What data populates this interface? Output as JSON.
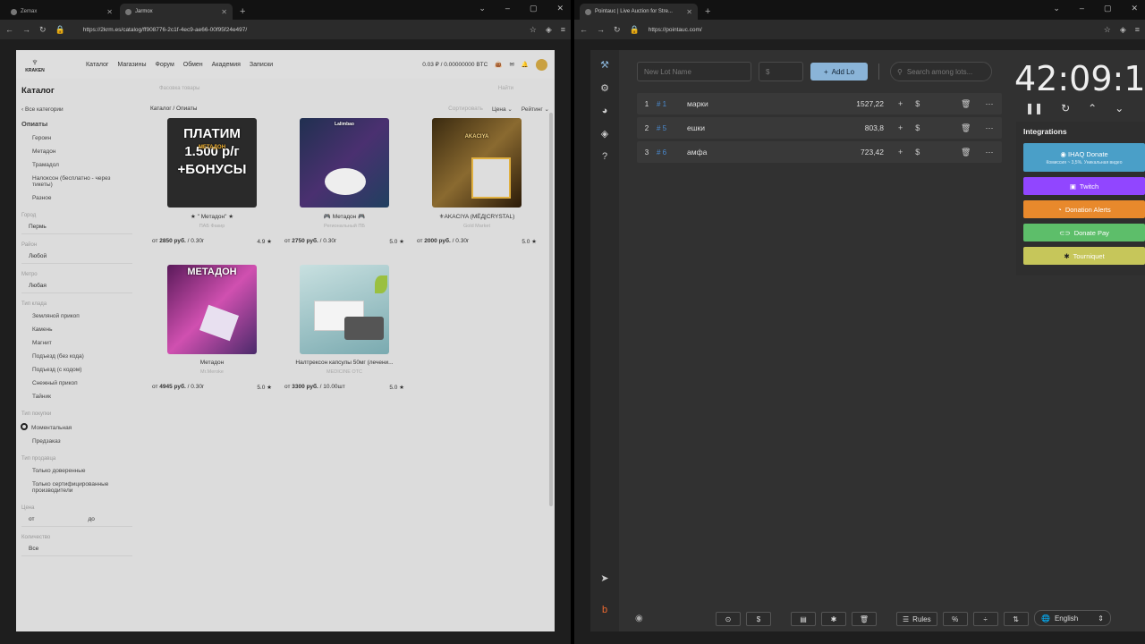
{
  "left": {
    "tabs": [
      {
        "label": "Zemax"
      },
      {
        "label": "Jarmox"
      }
    ],
    "url": "https://2krm.es/catalog/ff908776-2c1f-4ec9-ae66-00f95f24e497/",
    "logo_text": "KRAKEN",
    "nav": [
      "Каталог",
      "Магазины",
      "Форум",
      "Обмен",
      "Академия",
      "Записки"
    ],
    "balance": "0.03 ₽ / 0.00000000 BTC",
    "sidebar": {
      "title": "Каталог",
      "back": "Все категории",
      "group": "Опиаты",
      "items": [
        "Героин",
        "Метадон",
        "Трамадол",
        "Налоксон (бесплатно - через тикеты)",
        "Разное"
      ],
      "city_label": "Город",
      "city": "Пермь",
      "district_label": "Район",
      "district": "Любой",
      "metro_label": "Метро",
      "metro": "Любая",
      "type_label": "Тип клада",
      "types": [
        "Земляной прикоп",
        "Камень",
        "Магнит",
        "Подъезд (без кода)",
        "Подъезд (с кодом)",
        "Снежный прикоп",
        "Тайник"
      ],
      "buy_label": "Тип покупки",
      "buy_types": [
        "Моментальная",
        "Предзаказ"
      ],
      "seller_label": "Тип продавца",
      "seller_types": [
        "Только доверенные",
        "Только сертифицированные производители"
      ],
      "price_label": "Цена",
      "price_from": "от",
      "price_to": "до",
      "qty_label": "Количество",
      "qty": "Все"
    },
    "search_placeholder": "Фасовка товары",
    "search_btn": "Найти",
    "crumb": "Каталог / Опиаты",
    "sort_label": "Сортировать",
    "sort_price": "Цена",
    "sort_rating": "Рейтинг",
    "products": [
      {
        "name": "★ \" Метадон\" ★",
        "shop": "ПАБ Факир",
        "price_from": "от",
        "price": "2850 руб.",
        "unit": "/ 0.30г",
        "rating": "4.9",
        "img_text": "ПЛАТИМ 1.500 р/г +БОНУСЫ",
        "img_sub": "МЕТАДОН"
      },
      {
        "name": "🎮 Метадон 🎮",
        "shop": "Региональный ПБ",
        "price_from": "от",
        "price": "2750 руб.",
        "unit": "/ 0.30г",
        "rating": "5.0",
        "img_text": "Lalimbao"
      },
      {
        "name": "⚜AKACIYA (МЁД|CRYSTAL)",
        "shop": "Gold Market",
        "price_from": "от",
        "price": "2000 руб.",
        "unit": "/ 0.30г",
        "rating": "5.0",
        "img_text": "AKACIYA"
      },
      {
        "name": "Метадон",
        "shop": "Mr.Meroke",
        "price_from": "от",
        "price": "4945 руб.",
        "unit": "/ 0.30г",
        "rating": "5.0",
        "img_text": "МЕТАДОН"
      },
      {
        "name": "Налтрексон капсулы 50мг (лечени...",
        "shop": "MEDICINE OTC",
        "price_from": "от",
        "price": "3300 руб.",
        "unit": "/ 10.00шт",
        "rating": "5.0",
        "img_text": ""
      }
    ]
  },
  "right": {
    "tabs": [
      {
        "label": "Pointauc | Live Auction for Stre..."
      }
    ],
    "url": "https://pointauc.com/",
    "lot_placeholder": "New Lot Name",
    "amount_placeholder": "$",
    "add_label": "Add Lo",
    "search_placeholder": "Search among lots...",
    "lots": [
      {
        "n": "1",
        "id": "# 1",
        "name": "марки",
        "amount": "1527,22"
      },
      {
        "n": "2",
        "id": "# 5",
        "name": "ешки",
        "amount": "803,8"
      },
      {
        "n": "3",
        "id": "# 6",
        "name": "амфа",
        "amount": "723,42"
      }
    ],
    "timer": "42:09:1",
    "integrations_title": "Integrations",
    "integrations": [
      {
        "name": "IHAQ Donate",
        "sub": "Комиссия ~ 3,5%. Уникальная видео",
        "color": "#4a9fc8"
      },
      {
        "name": "Twitch",
        "color": "#9146ff"
      },
      {
        "name": "Donation Alerts",
        "color": "#e8892c"
      },
      {
        "name": "Donate Pay",
        "color": "#5dbe6a"
      },
      {
        "name": "Tourniquet",
        "color": "#c6c65a"
      }
    ],
    "bottom": {
      "rules": "Rules",
      "percent": "%"
    },
    "language": "English"
  }
}
